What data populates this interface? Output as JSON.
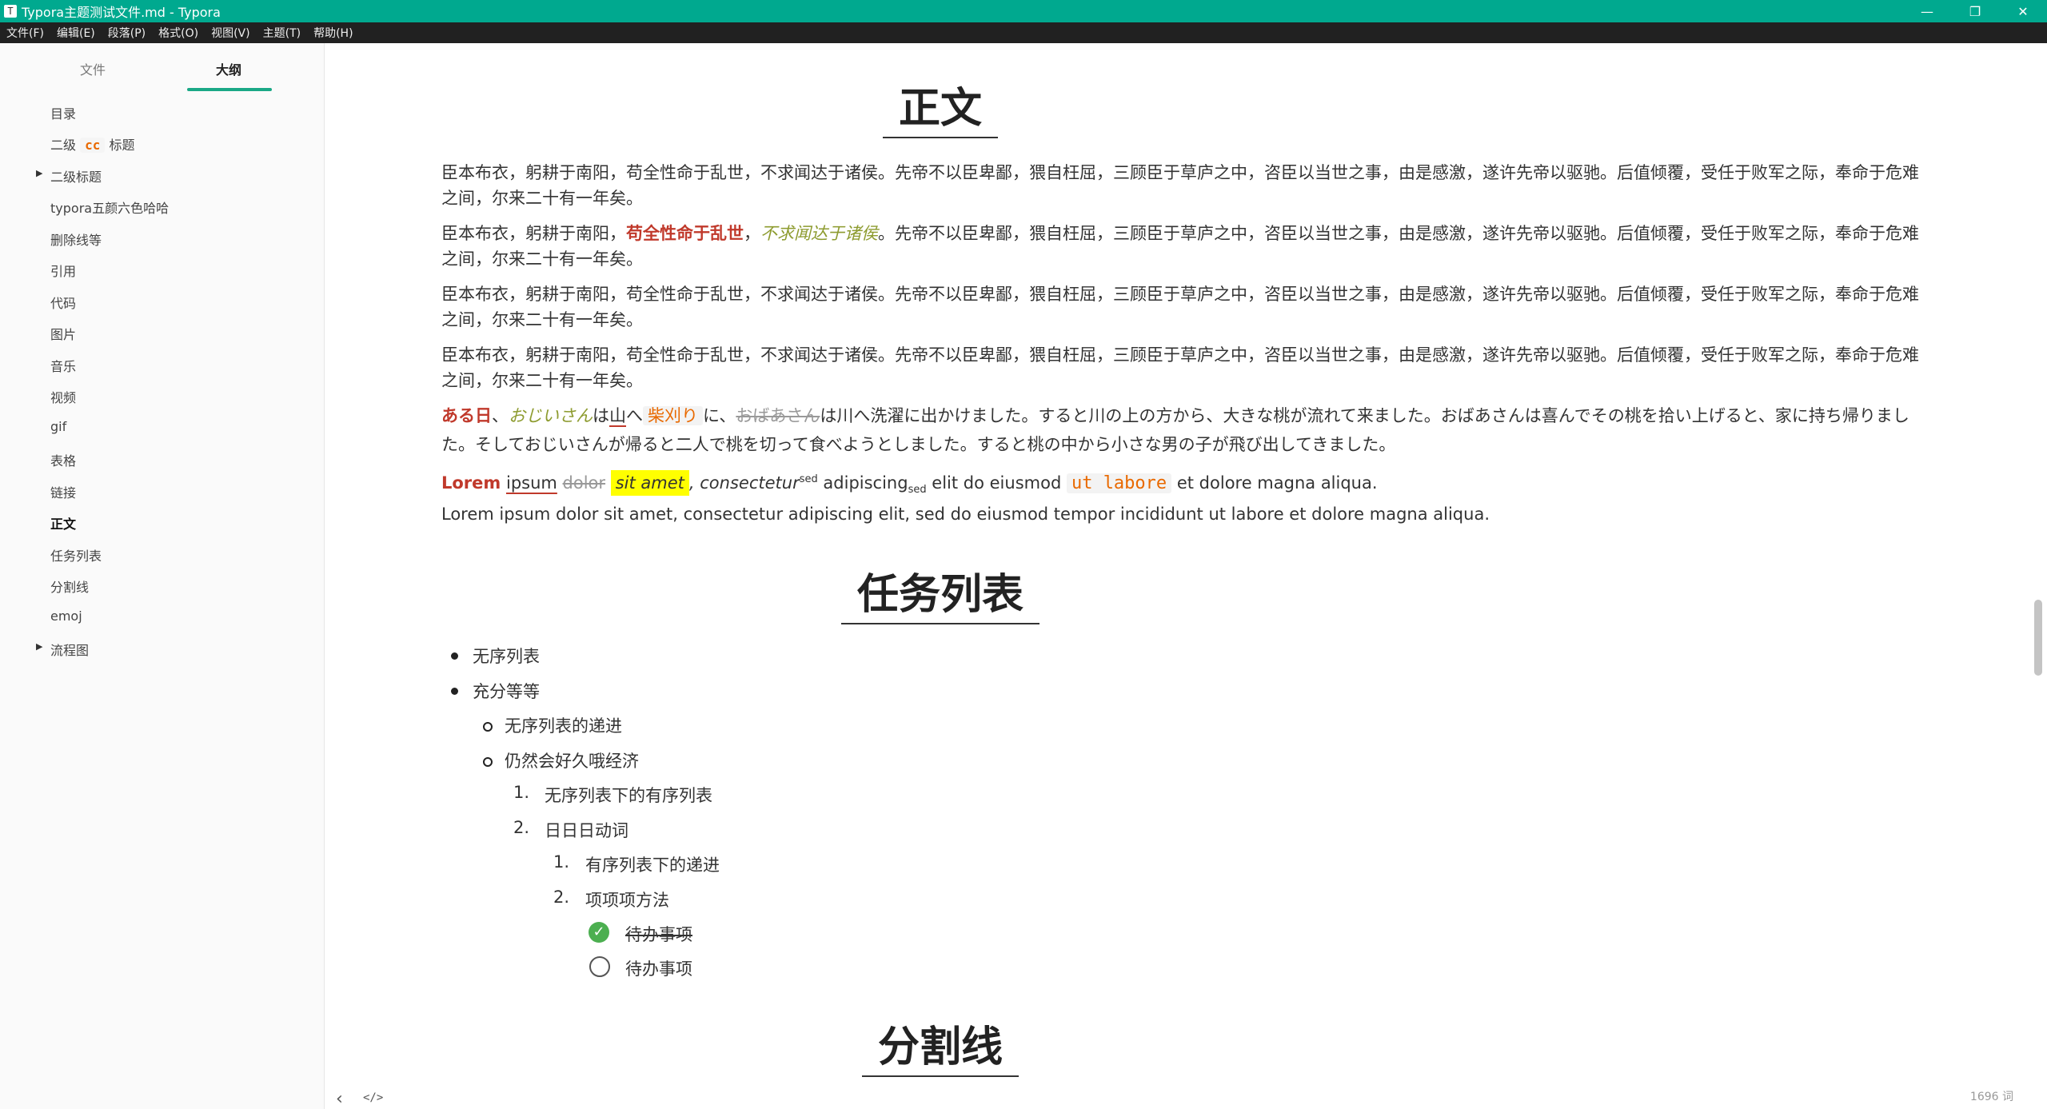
{
  "window": {
    "title": "Typora主题测试文件.md - Typora",
    "app_icon": "T",
    "minimize": "—",
    "restore": "❐",
    "close": "✕"
  },
  "menu": [
    "文件(F)",
    "编辑(E)",
    "段落(P)",
    "格式(O)",
    "视图(V)",
    "主题(T)",
    "帮助(H)"
  ],
  "sidebar": {
    "tab_files": "文件",
    "tab_outline": "大纲",
    "items": [
      {
        "label": "目录"
      },
      {
        "pre": "二级",
        "code": "cc",
        "post": "标题"
      },
      {
        "label": "二级标题",
        "collapsible": true
      },
      {
        "label": "typora五颜六色哈哈"
      },
      {
        "label": "删除线等"
      },
      {
        "label": "引用"
      },
      {
        "label": "代码"
      },
      {
        "label": "图片"
      },
      {
        "label": "音乐"
      },
      {
        "label": "视频"
      },
      {
        "label": "gif"
      },
      {
        "label": "表格"
      },
      {
        "label": "链接"
      },
      {
        "label": "正文",
        "active": true
      },
      {
        "label": "任务列表"
      },
      {
        "label": "分割线"
      },
      {
        "label": "emoj"
      },
      {
        "label": "流程图",
        "collapsible": true
      }
    ]
  },
  "content": {
    "h_body": "正文",
    "p1": "臣本布衣，躬耕于南阳，苟全性命于乱世，不求闻达于诸侯。先帝不以臣卑鄙，猥自枉屈，三顾臣于草庐之中，咨臣以当世之事，由是感激，遂许先帝以驱驰。后值倾覆，受任于败军之际，奉命于危难之间，尔来二十有一年矣。",
    "p2": {
      "a": "臣本布衣，躬耕于南阳，",
      "red": "苟全性命于乱世",
      "b": "，",
      "olive": "不求闻达于诸侯",
      "c": "。先帝不以臣卑鄙，猥自枉屈，三顾臣于草庐之中，咨臣以当世之事，由是感激，遂许先帝以驱驰。后值倾覆，受任于败军之际，奉命于危难之间，尔来二十有一年矣。"
    },
    "p3": "臣本布衣，躬耕于南阳，苟全性命于乱世，不求闻达于诸侯。先帝不以臣卑鄙，猥自枉屈，三顾臣于草庐之中，咨臣以当世之事，由是感激，遂许先帝以驱驰。后值倾覆，受任于败军之际，奉命于危难之间，尔来二十有一年矣。",
    "p4": "臣本布衣，躬耕于南阳，苟全性命于乱世，不求闻达于诸侯。先帝不以臣卑鄙，猥自枉屈，三顾臣于草庐之中，咨臣以当世之事，由是感激，遂许先帝以驱驰。后值倾覆，受任于败军之际，奉命于危难之间，尔来二十有一年矣。",
    "jp": {
      "red": "ある日",
      "s1": "、",
      "olive": "おじいさん",
      "s2": "は",
      "under": "山",
      "s3": "へ",
      "code": "柴刈り",
      "s4": "に、",
      "strike": "おばあさん",
      "rest": "は川へ洗濯に出かけました。すると川の上の方から、大きな桃が流れて来ました。おばあさんは喜んでその桃を拾い上げると、家に持ち帰りました。そしておじいさんが帰ると二人で桃を切って食べようとしました。すると桃の中から小さな男の子が飛び出してきました。"
    },
    "lorem1": {
      "red": "Lorem",
      "under": "ipsum",
      "strike": "dolor",
      "hl": "sit amet",
      "t1": ", consectetur",
      "sup": "sed",
      "t2": " adipiscing",
      "sub": "sed",
      "t3": " elit do eiusmod ",
      "code": "ut labore",
      "t4": " et dolore magna aliqua."
    },
    "lorem2": "Lorem ipsum dolor sit amet, consectetur adipiscing elit, sed do eiusmod tempor incididunt ut labore et dolore magna aliqua.",
    "h_tasks": "任务列表",
    "list": {
      "ul1": "无序列表",
      "ul2": "充分等等",
      "ul2a": "无序列表的递进",
      "ul2b": "仍然会好久哦经济",
      "ol1_num": "1.",
      "ol1": "无序列表下的有序列表",
      "ol2_num": "2.",
      "ol2": "日日日动词",
      "ol2a_num": "1.",
      "ol2a": "有序列表下的递进",
      "ol2b_num": "2.",
      "ol2b": "项项项方法",
      "task_done": "待办事项",
      "task_todo": "待办事项"
    },
    "h_divider": "分割线"
  },
  "footer": {
    "back_icon": "‹",
    "source_icon": "</>",
    "word_count": "1696 词"
  }
}
